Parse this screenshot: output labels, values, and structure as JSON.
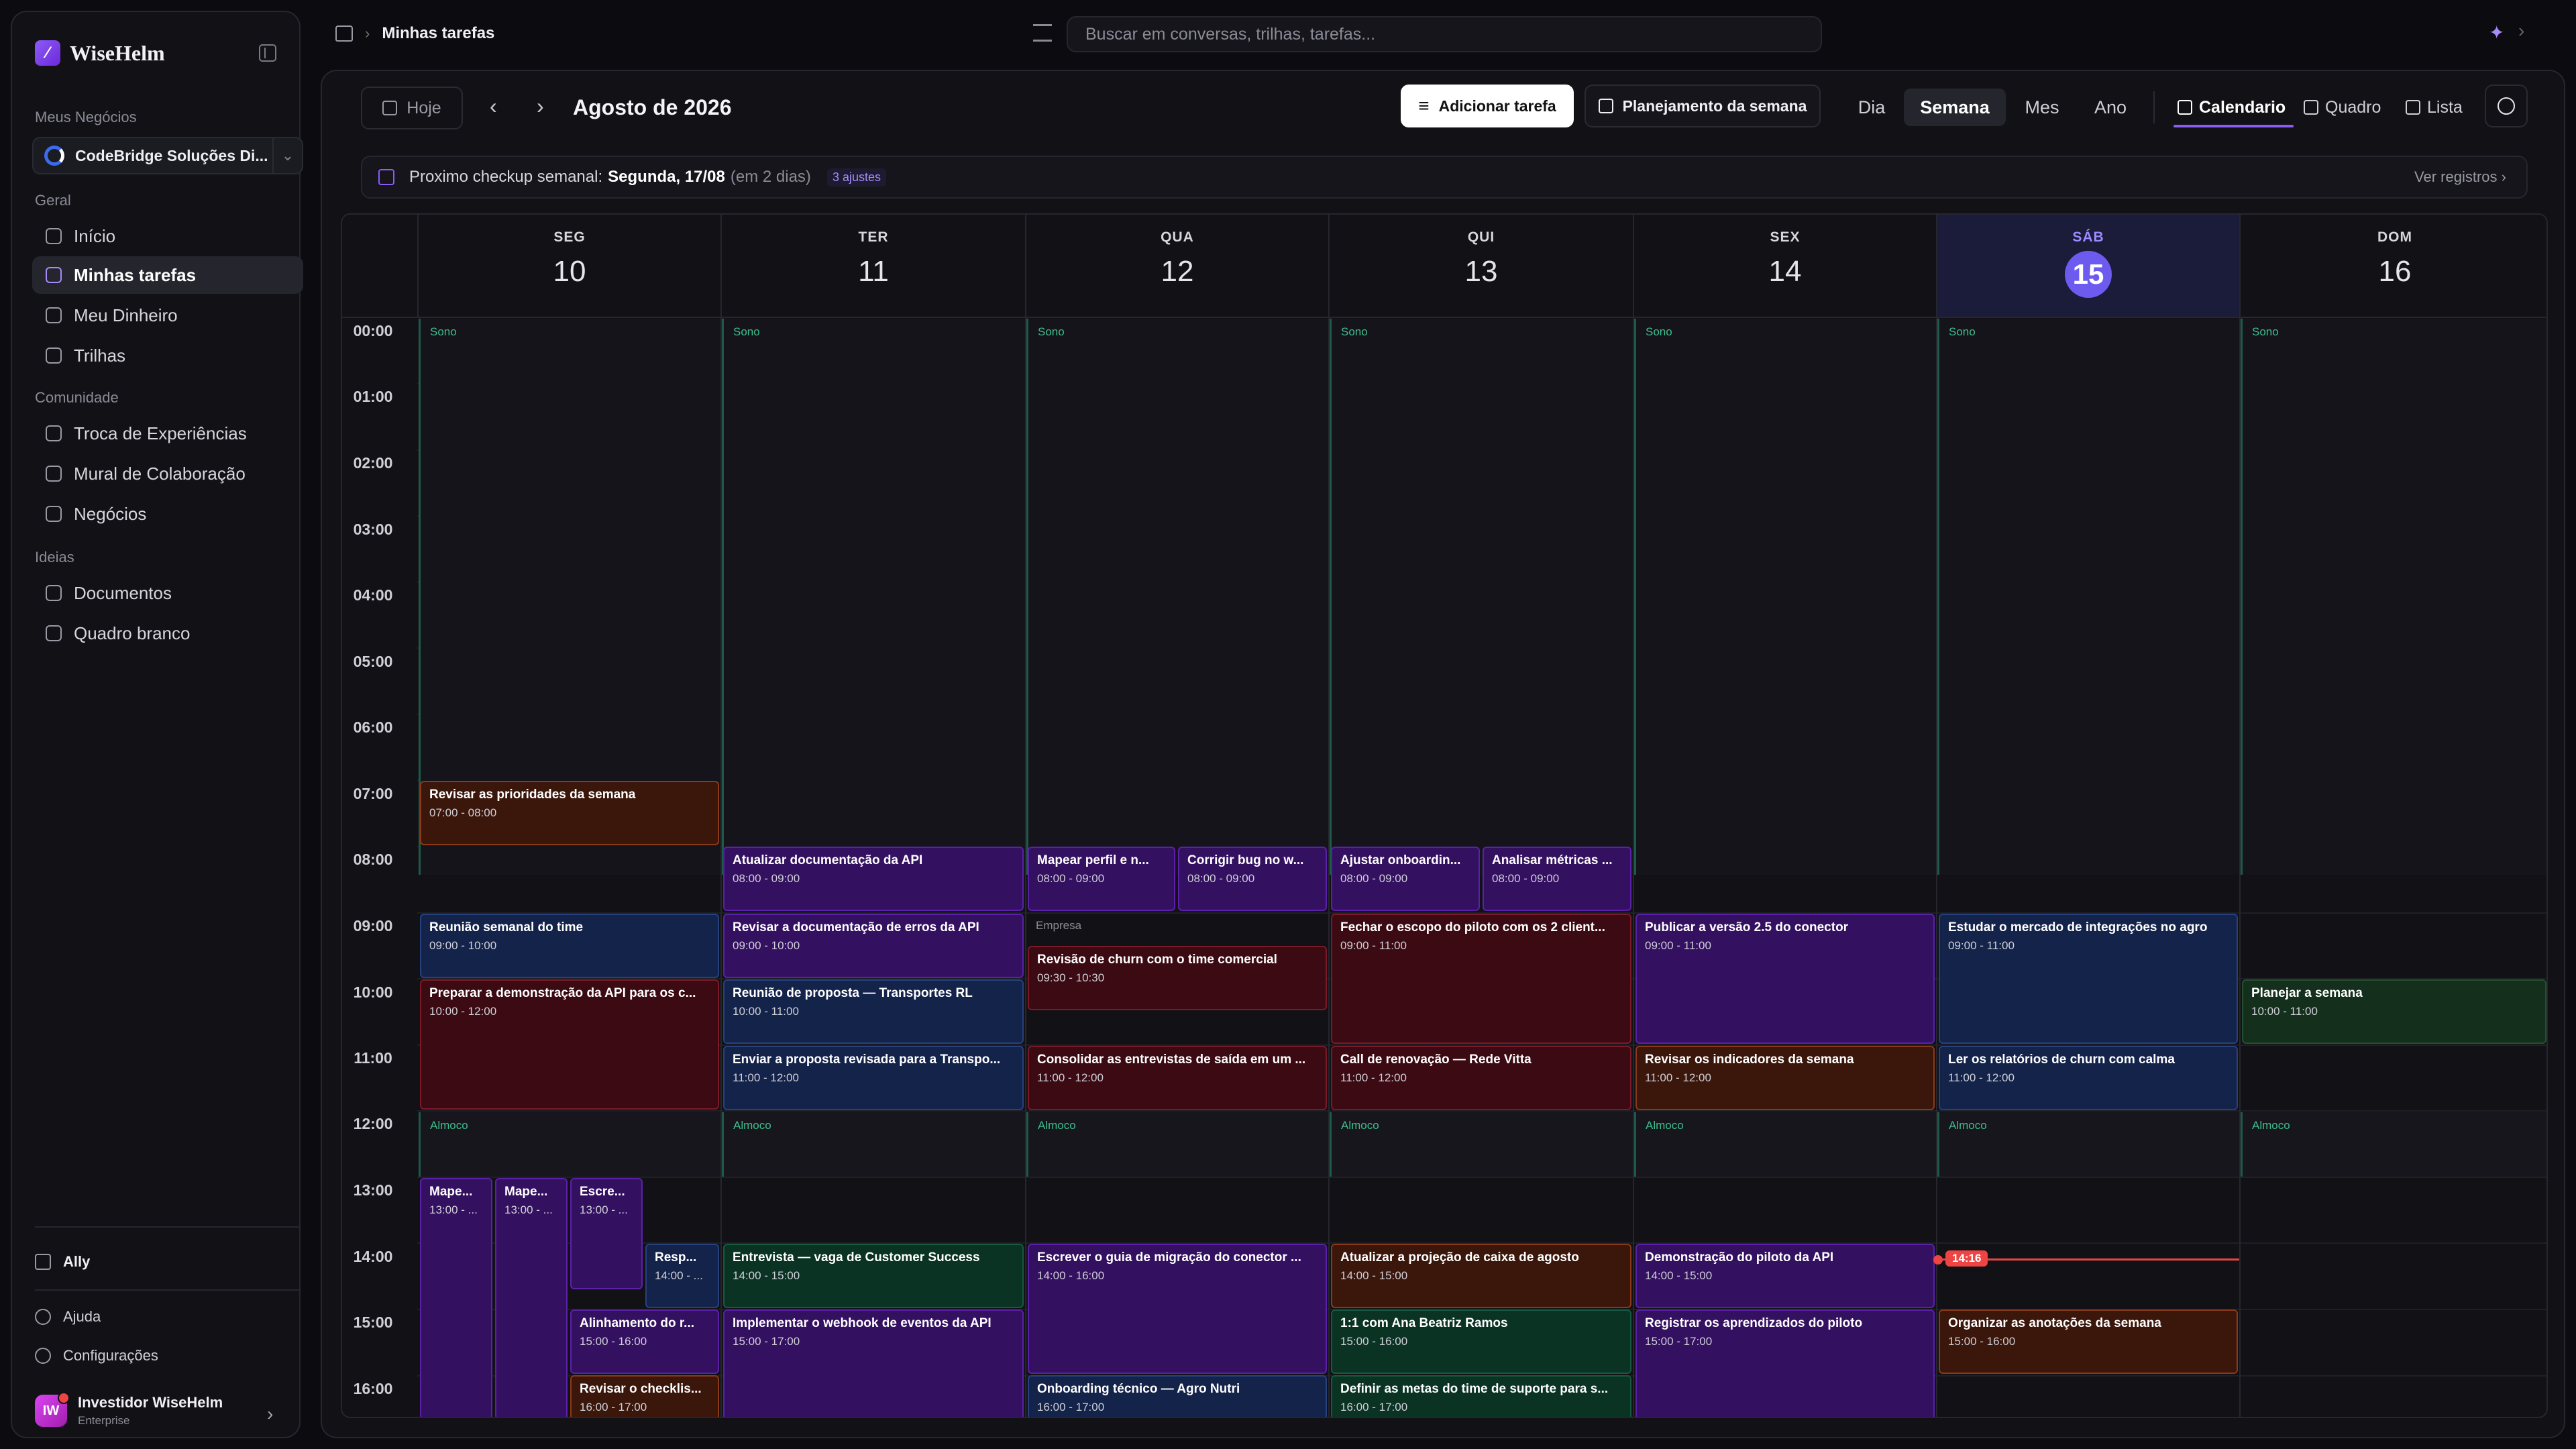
{
  "sidebar": {
    "brand": "WiseHelm",
    "business_section": "Meus Negócios",
    "business": "CodeBridge Soluções Di...",
    "sections": {
      "geral": "Geral",
      "comunidade": "Comunidade",
      "ideias": "Ideias"
    },
    "nav": {
      "inicio": "Início",
      "tarefas": "Minhas tarefas",
      "dinheiro": "Meu Dinheiro",
      "trilhas": "Trilhas",
      "troca": "Troca de Experiências",
      "mural": "Mural de Colaboração",
      "negocios": "Negócios",
      "documentos": "Documentos",
      "quadro": "Quadro branco"
    },
    "ally": "Ally",
    "ajuda": "Ajuda",
    "config": "Configurações",
    "user": {
      "initials": "IW",
      "name": "Investidor WiseHelm",
      "plan": "Enterprise"
    }
  },
  "topbar": {
    "title": "Minhas tarefas",
    "search_placeholder": "Buscar em conversas, trilhas, tarefas..."
  },
  "toolbar": {
    "hoje": "Hoje",
    "month": "Agosto de 2026",
    "add": "Adicionar tarefa",
    "plan": "Planejamento da semana",
    "views": {
      "dia": "Dia",
      "semana": "Semana",
      "mes": "Mes",
      "ano": "Ano"
    },
    "modes": {
      "calendario": "Calendario",
      "quadro": "Quadro",
      "lista": "Lista"
    }
  },
  "checkup": {
    "prefix": "Proximo checkup semanal:",
    "date": "Segunda, 17/08",
    "rel": "(em 2 dias)",
    "adjustments": "3 ajustes",
    "link": "Ver registros"
  },
  "days": [
    {
      "name": "SEG",
      "num": "10"
    },
    {
      "name": "TER",
      "num": "11"
    },
    {
      "name": "QUA",
      "num": "12"
    },
    {
      "name": "QUI",
      "num": "13"
    },
    {
      "name": "SEX",
      "num": "14"
    },
    {
      "name": "SÁB",
      "num": "15"
    },
    {
      "name": "DOM",
      "num": "16"
    }
  ],
  "hours": [
    "00:00",
    "01:00",
    "02:00",
    "03:00",
    "04:00",
    "05:00",
    "06:00",
    "07:00",
    "08:00",
    "09:00",
    "10:00",
    "11:00",
    "12:00",
    "13:00",
    "14:00",
    "15:00",
    "16:00"
  ],
  "blocks": {
    "sono": "Sono",
    "almoco": "Almoco",
    "empresa": "Empresa"
  },
  "now": "14:16",
  "events": {
    "e1": {
      "title": "Revisar as prioridades da semana",
      "time": "07:00 - 08:00"
    },
    "e2": {
      "title": "Reunião semanal do time",
      "time": "09:00 - 10:00"
    },
    "e3": {
      "title": "Preparar a demonstração da API para os c...",
      "time": "10:00 - 12:00"
    },
    "e4": {
      "title": "Mape...",
      "time": "13:00 - ..."
    },
    "e5": {
      "title": "Mape...",
      "time": "13:00 - ..."
    },
    "e6": {
      "title": "Escre...",
      "time": "13:00 - ..."
    },
    "e7": {
      "title": "Resp...",
      "time": "14:00 - ..."
    },
    "e8": {
      "title": "Alinhamento do r...",
      "time": "15:00 - 16:00"
    },
    "e9": {
      "title": "Revisar o checklis...",
      "time": "16:00 - 17:00"
    },
    "e10": {
      "title": "Atualizar documentação da API",
      "time": "08:00 - 09:00"
    },
    "e11": {
      "title": "Revisar a documentação de erros da API",
      "time": "09:00 - 10:00"
    },
    "e12": {
      "title": "Reunião de proposta — Transportes RL",
      "time": "10:00 - 11:00"
    },
    "e13": {
      "title": "Enviar a proposta revisada para a Transpo...",
      "time": "11:00 - 12:00"
    },
    "e14": {
      "title": "Entrevista — vaga de Customer Success",
      "time": "14:00 - 15:00"
    },
    "e15": {
      "title": "Implementar o webhook de eventos da API",
      "time": "15:00 - 17:00"
    },
    "e16": {
      "title": "Mapear perfil e n...",
      "time": "08:00 - 09:00"
    },
    "e17": {
      "title": "Corrigir bug no w...",
      "time": "08:00 - 09:00"
    },
    "e18": {
      "title": "Revisão de churn com o time comercial",
      "time": "09:30 - 10:30"
    },
    "e19": {
      "title": "Consolidar as entrevistas de saída em um ...",
      "time": "11:00 - 12:00"
    },
    "e20": {
      "title": "Escrever o guia de migração do conector ...",
      "time": "14:00 - 16:00"
    },
    "e21": {
      "title": "Onboarding técnico — Agro Nutri",
      "time": "16:00 - 17:00"
    },
    "e22": {
      "title": "Ajustar onboardin...",
      "time": "08:00 - 09:00"
    },
    "e23": {
      "title": "Analisar métricas ...",
      "time": "08:00 - 09:00"
    },
    "e24": {
      "title": "Fechar o escopo do piloto com os 2 client...",
      "time": "09:00 - 11:00"
    },
    "e25": {
      "title": "Call de renovação — Rede Vitta",
      "time": "11:00 - 12:00"
    },
    "e26": {
      "title": "Atualizar a projeção de caixa de agosto",
      "time": "14:00 - 15:00"
    },
    "e27": {
      "title": "1:1 com Ana Beatriz Ramos",
      "time": "15:00 - 16:00"
    },
    "e28": {
      "title": "Definir as metas do time de suporte para s...",
      "time": "16:00 - 17:00"
    },
    "e29": {
      "title": "Publicar a versão 2.5 do conector",
      "time": "09:00 - 11:00"
    },
    "e30": {
      "title": "Revisar os indicadores da semana",
      "time": "11:00 - 12:00"
    },
    "e31": {
      "title": "Demonstração do piloto da API",
      "time": "14:00 - 15:00"
    },
    "e32": {
      "title": "Registrar os aprendizados do piloto",
      "time": "15:00 - 17:00"
    },
    "e33": {
      "title": "Estudar o mercado de integrações no agro",
      "time": "09:00 - 11:00"
    },
    "e34": {
      "title": "Ler os relatórios de churn com calma",
      "time": "11:00 - 12:00"
    },
    "e35": {
      "title": "Organizar as anotações da semana",
      "time": "15:00 - 16:00"
    },
    "e36": {
      "title": "Planejar a semana",
      "time": "10:00 - 11:00"
    }
  }
}
